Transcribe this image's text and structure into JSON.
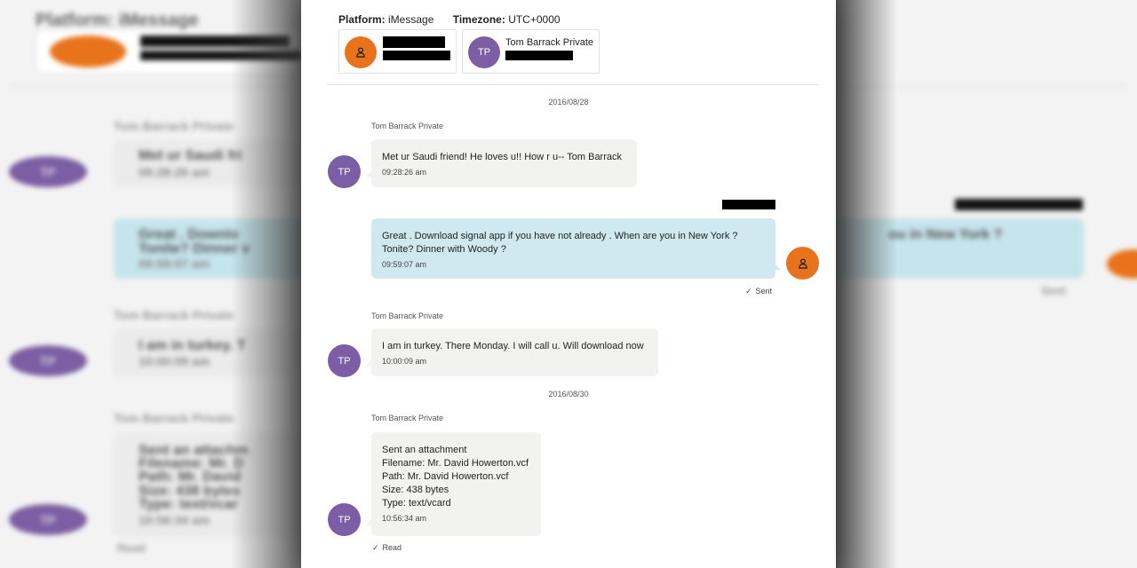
{
  "header": {
    "platform_label": "Platform:",
    "platform_value": "iMessage",
    "timezone_label": "Timezone:",
    "timezone_value": "UTC+0000"
  },
  "participants": [
    {
      "initials": "",
      "icon": "person-icon",
      "name": ""
    },
    {
      "initials": "TP",
      "icon": "",
      "name": "Tom Barrack Private"
    }
  ],
  "dates": [
    "2016/08/28",
    "2016/08/30"
  ],
  "messages": [
    {
      "sender": "Tom Barrack Private",
      "initials": "TP",
      "text": "Met ur Saudi friend!  He loves u!! How r u-- Tom Barrack",
      "time": "09:28:26 am"
    },
    {
      "sender": "",
      "text": "Great .  Download signal app if you have not already .  When are you in New York ?\nTonite? Dinner with Woody ?",
      "time": "09:59:07 am",
      "status": "Sent"
    },
    {
      "sender": "Tom Barrack Private",
      "initials": "TP",
      "text": "I am in turkey. There Monday. I will call u. Will download now",
      "time": "10:00:09 am"
    },
    {
      "sender": "Tom Barrack Private",
      "initials": "TP",
      "text": "Sent an attachment\nFilename: Mr. David Howerton.vcf\nPath: Mr. David Howerton.vcf\nSize: 438 bytes\nType: text/vcard",
      "time": "10:56:34 am",
      "status": "Read"
    }
  ],
  "background": {
    "platform_text": "Platform: iMessage",
    "sender_text": "Tom Barrack Private",
    "msg1": "Met ur Saudi fri",
    "msg1_time": "09:28:26 am",
    "msg2": "Great .  Downlo",
    "msg2b": "Tonite? Dinner v",
    "msg2_time": "09:59:07 am",
    "msg2_right": "ou in New York ?",
    "sent": "Sent",
    "msg3": "I am in turkey. T",
    "msg3_time": "10:00:09 am",
    "msg4a": "Sent an attachm",
    "msg4b": "Filename: Mr. D",
    "msg4c": "Path: Mr. David",
    "msg4d": "Size: 438 bytes",
    "msg4e": "Type: text/vcar",
    "msg4_time": "10:56:34 am",
    "read": "Read",
    "tp": "TP"
  },
  "colors": {
    "accent_orange": "#e8731c",
    "avatar_purple": "#7b5ea3",
    "outgoing_bubble": "#d0e9f1",
    "incoming_bubble": "#f2f2f0"
  }
}
